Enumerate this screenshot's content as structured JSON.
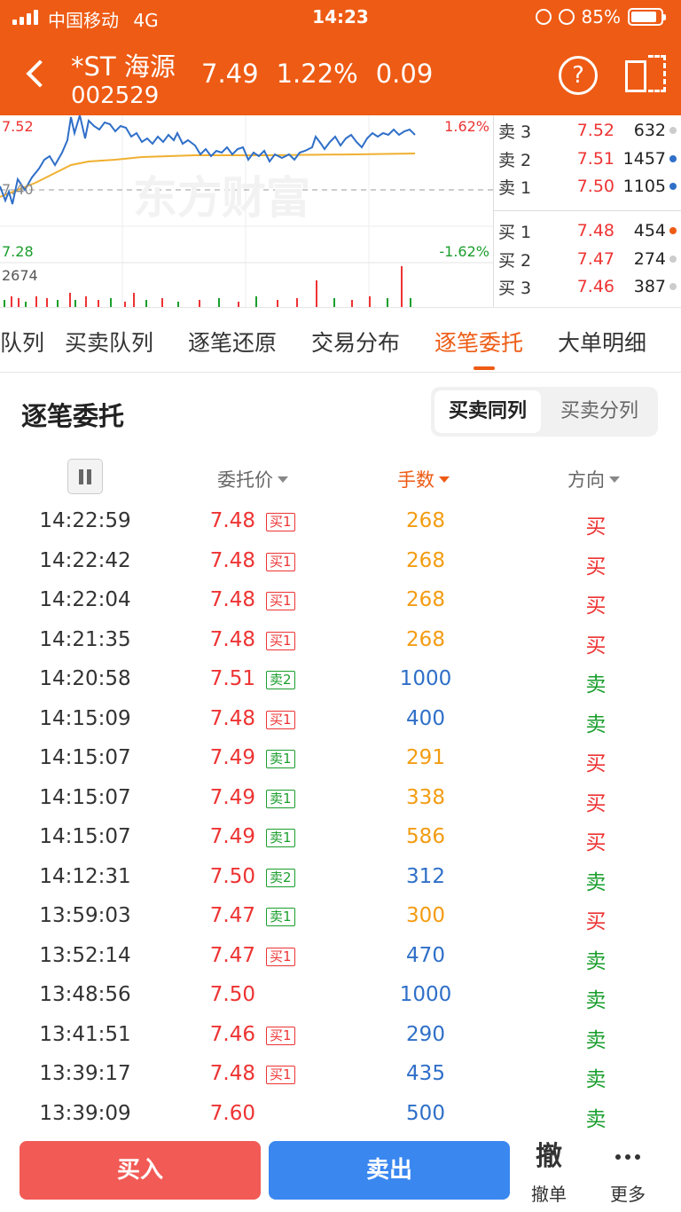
{
  "status": {
    "carrier": "中国移动",
    "network": "4G",
    "time": "14:23",
    "battery": "85%"
  },
  "header": {
    "name": "*ST 海源",
    "code": "002529",
    "price": "7.49",
    "change_pct": "1.22%",
    "change": "0.09",
    "help_label": "?"
  },
  "chart": {
    "high_price": "7.52",
    "high_pct": "1.62%",
    "low_price": "7.28",
    "low_pct": "-1.62%",
    "base_price": "7.40",
    "volume_max": "2674",
    "watermark": "东方财富",
    "colors": {
      "price_line": "#2f6fc8",
      "avg_line": "#f0b030",
      "up": "#e33",
      "down": "#1a9e2c"
    }
  },
  "depth": {
    "sell": [
      {
        "name": "卖 3",
        "price": "7.52",
        "vol": "632",
        "dot": "#cccccc"
      },
      {
        "name": "卖 2",
        "price": "7.51",
        "vol": "1457",
        "dot": "#2f6fc8"
      },
      {
        "name": "卖 1",
        "price": "7.50",
        "vol": "1105",
        "dot": "#2f6fc8"
      }
    ],
    "buy": [
      {
        "name": "买 1",
        "price": "7.48",
        "vol": "454",
        "dot": "#ee5b14"
      },
      {
        "name": "买 2",
        "price": "7.47",
        "vol": "274",
        "dot": "#cccccc"
      },
      {
        "name": "买 3",
        "price": "7.46",
        "vol": "387",
        "dot": "#cccccc"
      }
    ]
  },
  "tabs": [
    {
      "label": "队列",
      "active": false
    },
    {
      "label": "买卖队列",
      "active": false
    },
    {
      "label": "逐笔还原",
      "active": false
    },
    {
      "label": "交易分布",
      "active": false
    },
    {
      "label": "逐笔委托",
      "active": true
    },
    {
      "label": "大单明细",
      "active": false
    }
  ],
  "section": {
    "title": "逐笔委托",
    "seg_on": "买卖同列",
    "seg_off": "买卖分列",
    "col_price": "委托价",
    "col_qty": "手数",
    "col_dir": "方向"
  },
  "rows": [
    {
      "time": "14:22:59",
      "price": "7.48",
      "tag": "买1",
      "tag_color": "red",
      "qty": "268",
      "qty_color": "orange",
      "dir": "买",
      "dir_color": "red"
    },
    {
      "time": "14:22:42",
      "price": "7.48",
      "tag": "买1",
      "tag_color": "red",
      "qty": "268",
      "qty_color": "orange",
      "dir": "买",
      "dir_color": "red"
    },
    {
      "time": "14:22:04",
      "price": "7.48",
      "tag": "买1",
      "tag_color": "red",
      "qty": "268",
      "qty_color": "orange",
      "dir": "买",
      "dir_color": "red"
    },
    {
      "time": "14:21:35",
      "price": "7.48",
      "tag": "买1",
      "tag_color": "red",
      "qty": "268",
      "qty_color": "orange",
      "dir": "买",
      "dir_color": "red"
    },
    {
      "time": "14:20:58",
      "price": "7.51",
      "tag": "卖2",
      "tag_color": "green",
      "qty": "1000",
      "qty_color": "blue",
      "dir": "卖",
      "dir_color": "green"
    },
    {
      "time": "14:15:09",
      "price": "7.48",
      "tag": "买1",
      "tag_color": "red",
      "qty": "400",
      "qty_color": "blue",
      "dir": "卖",
      "dir_color": "green"
    },
    {
      "time": "14:15:07",
      "price": "7.49",
      "tag": "卖1",
      "tag_color": "green",
      "qty": "291",
      "qty_color": "orange",
      "dir": "买",
      "dir_color": "red"
    },
    {
      "time": "14:15:07",
      "price": "7.49",
      "tag": "卖1",
      "tag_color": "green",
      "qty": "338",
      "qty_color": "orange",
      "dir": "买",
      "dir_color": "red"
    },
    {
      "time": "14:15:07",
      "price": "7.49",
      "tag": "卖1",
      "tag_color": "green",
      "qty": "586",
      "qty_color": "orange",
      "dir": "买",
      "dir_color": "red"
    },
    {
      "time": "14:12:31",
      "price": "7.50",
      "tag": "卖2",
      "tag_color": "green",
      "qty": "312",
      "qty_color": "blue",
      "dir": "卖",
      "dir_color": "green"
    },
    {
      "time": "13:59:03",
      "price": "7.47",
      "tag": "卖1",
      "tag_color": "green",
      "qty": "300",
      "qty_color": "orange",
      "dir": "买",
      "dir_color": "red"
    },
    {
      "time": "13:52:14",
      "price": "7.47",
      "tag": "买1",
      "tag_color": "red",
      "qty": "470",
      "qty_color": "blue",
      "dir": "卖",
      "dir_color": "green"
    },
    {
      "time": "13:48:56",
      "price": "7.50",
      "tag": "",
      "tag_color": "",
      "qty": "1000",
      "qty_color": "blue",
      "dir": "卖",
      "dir_color": "green"
    },
    {
      "time": "13:41:51",
      "price": "7.46",
      "tag": "买1",
      "tag_color": "red",
      "qty": "290",
      "qty_color": "blue",
      "dir": "卖",
      "dir_color": "green"
    },
    {
      "time": "13:39:17",
      "price": "7.48",
      "tag": "买1",
      "tag_color": "red",
      "qty": "435",
      "qty_color": "blue",
      "dir": "卖",
      "dir_color": "green"
    },
    {
      "time": "13:39:09",
      "price": "7.60",
      "tag": "",
      "tag_color": "",
      "qty": "500",
      "qty_color": "blue",
      "dir": "卖",
      "dir_color": "green"
    }
  ],
  "bottom": {
    "buy": "买入",
    "sell": "卖出",
    "cancel_icon_char": "撤",
    "cancel_label": "撤单",
    "more_label": "更多"
  }
}
